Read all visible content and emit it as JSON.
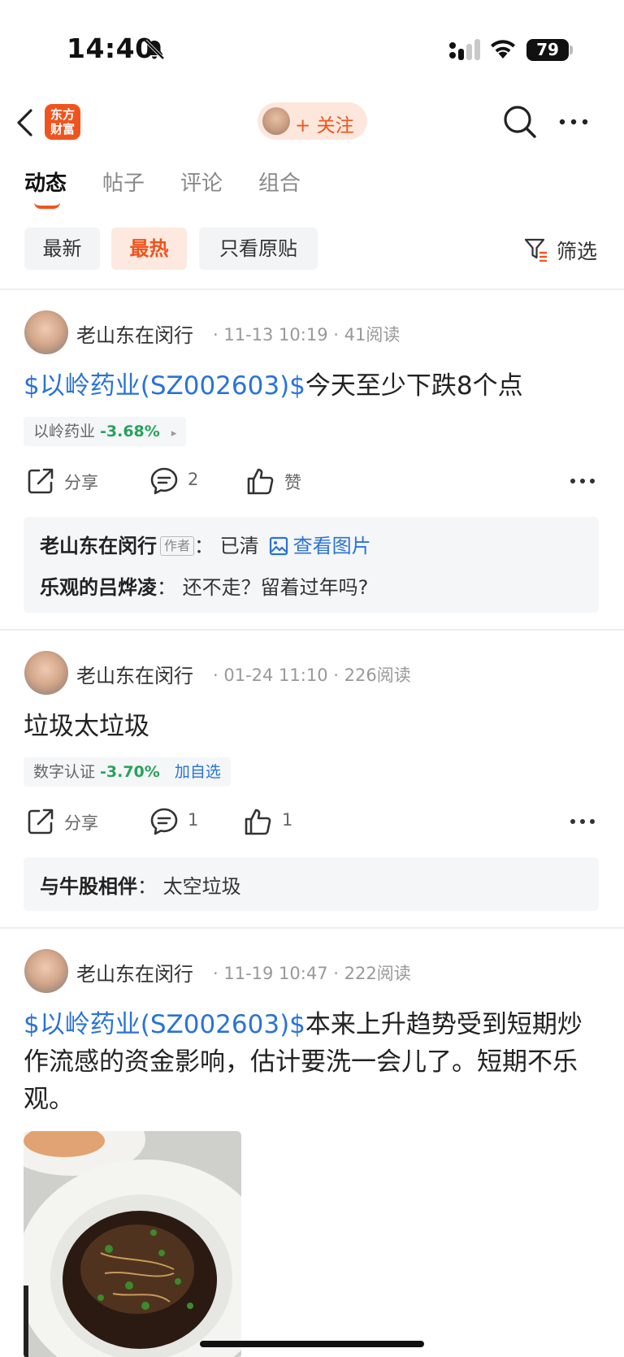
{
  "status_bar": {
    "time": "14:40",
    "battery": "79"
  },
  "nav": {
    "logo_text": "东方\n财富",
    "follow_label": "+ 关注"
  },
  "tabs": [
    "动态",
    "帖子",
    "评论",
    "组合"
  ],
  "filters": {
    "chips": [
      "最新",
      "最热",
      "只看原贴"
    ],
    "filter_label": "筛选"
  },
  "posts": [
    {
      "author": "老山东在闵行",
      "time": "11-13 10:19",
      "reads": "41阅读",
      "stock_link": "$以岭药业(SZ002603)$",
      "text": "今天至少下跌8个点",
      "quote": {
        "name": "以岭药业",
        "pct": "-3.68%",
        "arrow": "▸"
      },
      "actions": {
        "share": "分享",
        "comments": "2",
        "like": "赞"
      },
      "comments": [
        {
          "user": "老山东在闵行",
          "tag": "作者",
          "text": "已清",
          "link": "查看图片"
        },
        {
          "user": "乐观的吕烨凌",
          "text": "还不走？留着过年吗?"
        }
      ]
    },
    {
      "author": "老山东在闵行",
      "time": "01-24 11:10",
      "reads": "226阅读",
      "text": "垃圾太垃圾",
      "quote": {
        "name": "数字认证",
        "pct": "-3.70%",
        "add": "加自选"
      },
      "actions": {
        "share": "分享",
        "comments": "1",
        "like": "1"
      },
      "comments": [
        {
          "user": "与牛股相伴",
          "text": "太空垃圾"
        }
      ]
    },
    {
      "author": "老山东在闵行",
      "time": "11-19 10:47",
      "reads": "222阅读",
      "stock_link": "$以岭药业(SZ002603)$",
      "text": "本来上升趋势受到短期炒作流感的资金影响，估计要洗一会儿了。短期不乐观。"
    }
  ],
  "colors": {
    "accent": "#f0541e",
    "link": "#2a73d6",
    "down": "#27a35a"
  },
  "icons": [
    "back-icon",
    "search-icon",
    "more-icon",
    "share-icon",
    "comment-icon",
    "like-icon",
    "filter-icon",
    "image-icon"
  ]
}
